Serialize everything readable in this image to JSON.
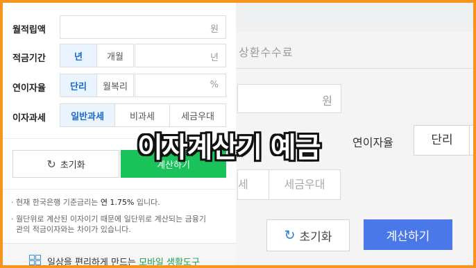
{
  "left": {
    "rows": [
      {
        "label": "월적립액",
        "unit": "원"
      },
      {
        "label": "적금기간",
        "seg1": "년",
        "seg2": "개월",
        "unit": "년"
      },
      {
        "label": "연이자율",
        "seg1": "단리",
        "seg2": "월복리",
        "unit": "%"
      },
      {
        "label": "이자과세",
        "opt1": "일반과세",
        "opt2": "비과세",
        "opt3": "세금우대"
      }
    ],
    "reset_label": "초기화",
    "calc_label": "계산하기",
    "note1_prefix": "현재 한국은행 기준금리는 ",
    "note1_rate": "연 1.75%",
    "note1_suffix": " 입니다.",
    "note2_line1": "월단위로 계산된 이자이기 때문에 일단위로 계산되는 금융기",
    "note2_line2": "관의 적금이자와는 차이가 있습니다.",
    "bottom_prefix": "일상을 편리하게 만드는 ",
    "bottom_highlight": "모바일 생활도구"
  },
  "right": {
    "fee_label": "상환수수료",
    "won_unit": "원",
    "rate_label": "연이자율",
    "danri": "단리",
    "tax_partial": "세",
    "tax_pref": "세금우대",
    "reset_label": "초기화",
    "calc_label": "계산하기"
  },
  "title": "이자계산기 예금",
  "colors": {
    "border": "#f7941d",
    "accent_green": "#19c35a",
    "accent_blue": "#4a78e8"
  }
}
